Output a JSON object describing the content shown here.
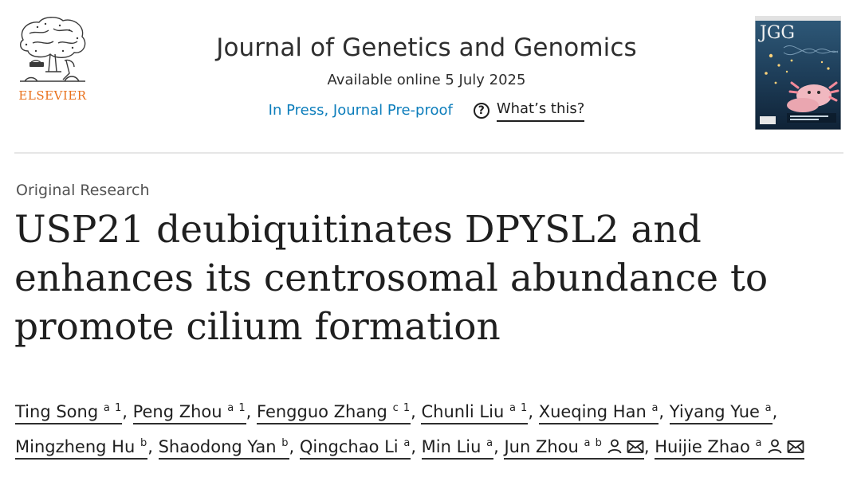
{
  "header": {
    "publisher": "ELSEVIER",
    "journal_title": "Journal of Genetics and Genomics",
    "available_online": "Available online 5 July 2025",
    "status_link": "In Press, Journal Pre-proof",
    "whats_this": "What’s this?",
    "cover_abbrev": "JGG"
  },
  "article": {
    "type": "Original Research",
    "title": "USP21 deubiquitinates DPYSL2 and enhances its centrosomal abundance to promote cilium formation",
    "authors": [
      {
        "name": "Ting Song",
        "aff": "a 1",
        "person_icon": false,
        "mail_icon": false
      },
      {
        "name": "Peng Zhou",
        "aff": "a 1",
        "person_icon": false,
        "mail_icon": false
      },
      {
        "name": "Fengguo Zhang",
        "aff": "c 1",
        "person_icon": false,
        "mail_icon": false
      },
      {
        "name": "Chunli Liu",
        "aff": "a 1",
        "person_icon": false,
        "mail_icon": false
      },
      {
        "name": "Xueqing Han",
        "aff": "a",
        "person_icon": false,
        "mail_icon": false
      },
      {
        "name": "Yiyang Yue",
        "aff": "a",
        "person_icon": false,
        "mail_icon": false
      },
      {
        "name": "Mingzheng Hu",
        "aff": "b",
        "person_icon": false,
        "mail_icon": false
      },
      {
        "name": "Shaodong Yan",
        "aff": "b",
        "person_icon": false,
        "mail_icon": false
      },
      {
        "name": "Qingchao Li",
        "aff": "a",
        "person_icon": false,
        "mail_icon": false
      },
      {
        "name": "Min Liu",
        "aff": "a",
        "person_icon": false,
        "mail_icon": false
      },
      {
        "name": "Jun Zhou",
        "aff": "a b",
        "person_icon": true,
        "mail_icon": true
      },
      {
        "name": "Huijie Zhao",
        "aff": "a",
        "person_icon": true,
        "mail_icon": true
      }
    ]
  },
  "colors": {
    "elsevier_orange": "#e9711c",
    "link_blue": "#0c7dbb",
    "text": "#1f1f1f"
  },
  "icons": {
    "help": "question-circle-icon",
    "person": "person-icon",
    "mail": "envelope-icon"
  }
}
